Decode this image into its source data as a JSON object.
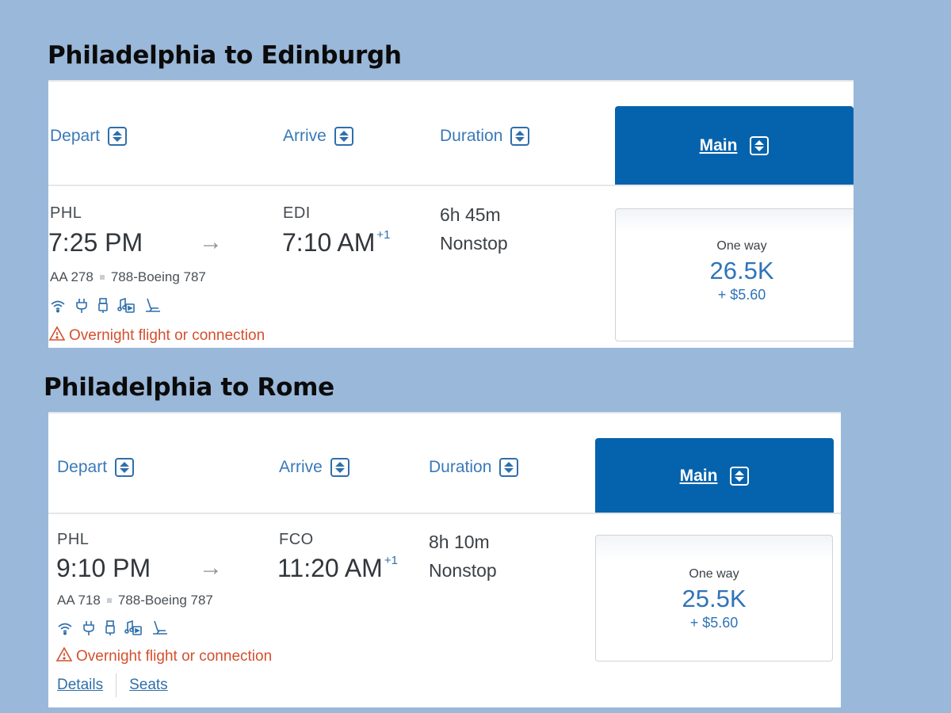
{
  "cards": [
    {
      "title": "Philadelphia to Edinburgh",
      "headers": {
        "depart": "Depart",
        "arrive": "Arrive",
        "duration": "Duration",
        "cabin": "Main"
      },
      "origin": "PHL",
      "depart_time": "7:25 PM",
      "destination": "EDI",
      "arrive_time": "7:10 AM",
      "day_offset": "+1",
      "flight_number": "AA 278",
      "aircraft": "788-Boeing 787",
      "amenities": [
        "wifi-icon",
        "power-outlet-icon",
        "usb-icon",
        "entertainment-icon",
        "lie-flat-seat-icon"
      ],
      "warning": "Overnight flight or connection",
      "duration": "6h 45m",
      "stops": "Nonstop",
      "price": {
        "label": "One way",
        "miles": "26.5K",
        "fee": "+ $5.60"
      }
    },
    {
      "title": "Philadelphia to Rome",
      "headers": {
        "depart": "Depart",
        "arrive": "Arrive",
        "duration": "Duration",
        "cabin": "Main"
      },
      "origin": "PHL",
      "depart_time": "9:10 PM",
      "destination": "FCO",
      "arrive_time": "11:20 AM",
      "day_offset": "+1",
      "flight_number": "AA 718",
      "aircraft": "788-Boeing 787",
      "amenities": [
        "wifi-icon",
        "power-outlet-icon",
        "usb-icon",
        "entertainment-icon",
        "lie-flat-seat-icon"
      ],
      "warning": "Overnight flight or connection",
      "duration": "8h 10m",
      "stops": "Nonstop",
      "price": {
        "label": "One way",
        "miles": "25.5K",
        "fee": "+ $5.60"
      },
      "links": {
        "details": "Details",
        "seats": "Seats"
      }
    }
  ],
  "colors": {
    "background": "#9ab8d9",
    "brand": "#0563ad",
    "link": "#2f6faa",
    "warning": "#d4502e"
  }
}
